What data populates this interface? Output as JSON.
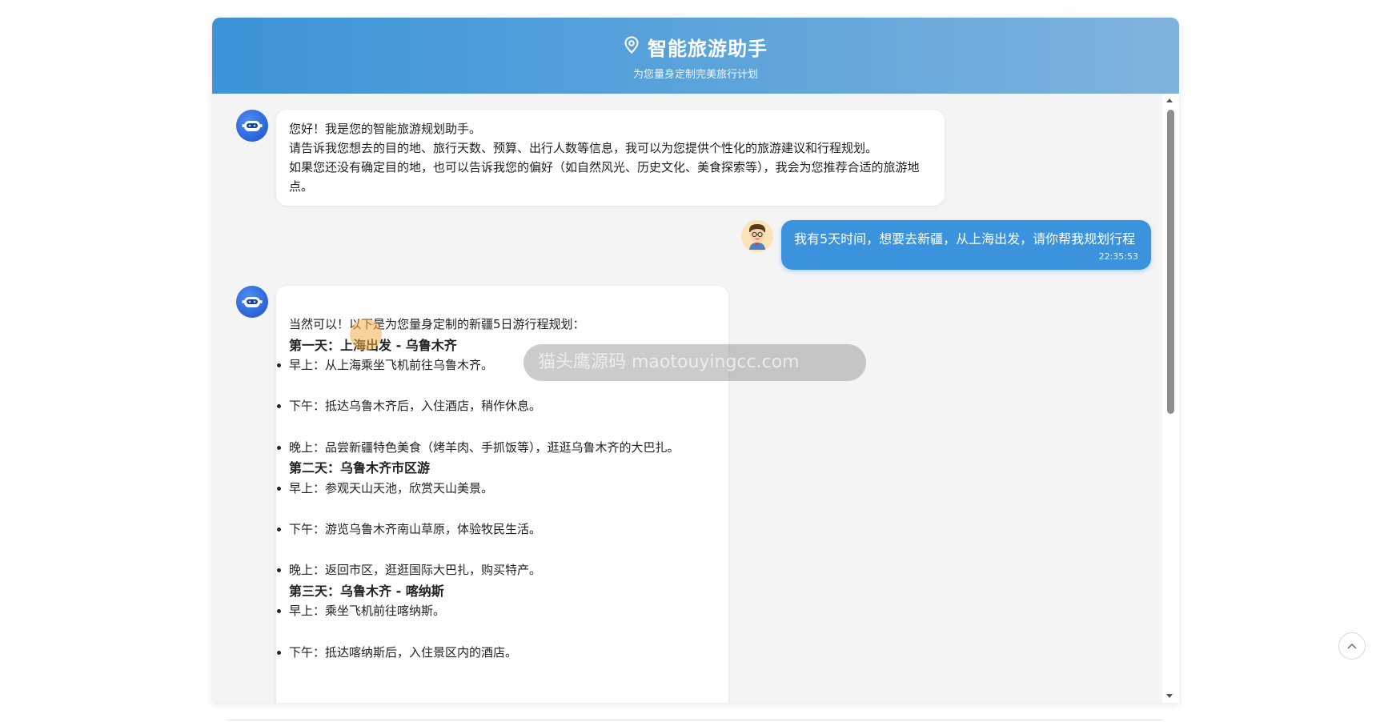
{
  "header": {
    "title": "智能旅游助手",
    "subtitle": "为您量身定制完美旅行计划",
    "icon": "location-pin-icon"
  },
  "messages": {
    "greeting": {
      "line1": "您好！我是您的智能旅游规划助手。",
      "line2": "请告诉我您想去的目的地、旅行天数、预算、出行人数等信息，我可以为您提供个性化的旅游建议和行程规划。",
      "line3": "如果您还没有确定目的地，也可以告诉我您的偏好（如自然风光、历史文化、美食探索等），我会为您推荐合适的旅游地点。"
    },
    "user": {
      "text": "我有5天时间，想要去新疆，从上海出发，请你帮我规划行程",
      "time": "22:35:53"
    },
    "plan": {
      "intro": "当然可以！以下是为您量身定制的新疆5日游行程规划：",
      "day1": {
        "title": "第一天：上海出发 - 乌鲁木齐",
        "items": [
          "早上：从上海乘坐飞机前往乌鲁木齐。",
          "下午：抵达乌鲁木齐后，入住酒店，稍作休息。",
          "晚上：品尝新疆特色美食（烤羊肉、手抓饭等），逛逛乌鲁木齐的大巴扎。"
        ]
      },
      "day2": {
        "title": "第二天：乌鲁木齐市区游",
        "items": [
          "早上：参观天山天池，欣赏天山美景。",
          "下午：游览乌鲁木齐南山草原，体验牧民生活。",
          "晚上：返回市区，逛逛国际大巴扎，购买特产。"
        ]
      },
      "day3": {
        "title": "第三天：乌鲁木齐 - 喀纳斯",
        "items": [
          "早上：乘坐飞机前往喀纳斯。",
          "下午：抵达喀纳斯后，入住景区内的酒店。"
        ]
      }
    }
  },
  "watermark": "猫头鹰源码 maotouyingcc.com",
  "colors": {
    "header_start": "#3d93d6",
    "header_end": "#7fb3dc",
    "user_bubble": "#3a93dc",
    "chat_bg": "#f4f4f5"
  }
}
